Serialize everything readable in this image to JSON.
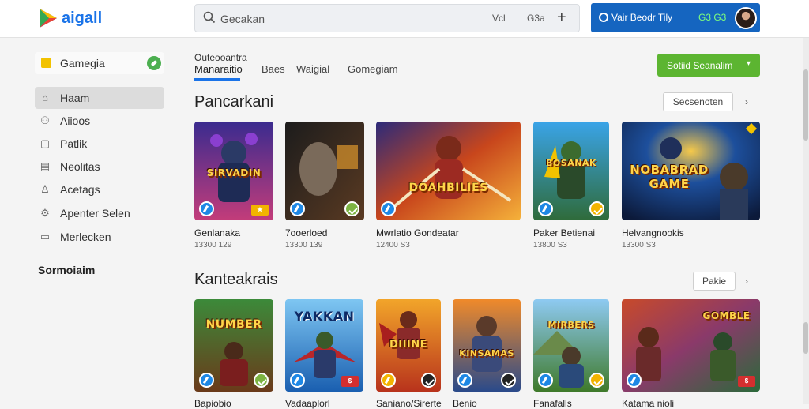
{
  "brand": {
    "name": "aigall"
  },
  "search": {
    "placeholder": "Gecakan",
    "filter_label": "Vcl",
    "count_label": "G3a"
  },
  "account": {
    "label": "Vair Beodr Tily",
    "balance": "G3 G3"
  },
  "sidebar": {
    "header_label": "Gamegia",
    "items": [
      {
        "label": "Haam",
        "icon": "home-icon"
      },
      {
        "label": "Aiioos",
        "icon": "gamepad-icon"
      },
      {
        "label": "Patlik",
        "icon": "list-icon"
      },
      {
        "label": "Neolitas",
        "icon": "news-icon"
      },
      {
        "label": "Acetags",
        "icon": "user-icon"
      },
      {
        "label": "Apenter Selen",
        "icon": "settings-icon"
      },
      {
        "label": "Merlecken",
        "icon": "folder-icon"
      }
    ],
    "section_label": "Sormoiaim"
  },
  "tabs": {
    "kicker": "Outeooantra",
    "items": [
      "Manaraitio",
      "Baes",
      "Waigial",
      "Gomegiam"
    ],
    "cta_label": "Sotiid Seanalim"
  },
  "sections": [
    {
      "title": "Pancarkani",
      "button_label": "Secsenoten",
      "cards": [
        {
          "title": "Genlanaka",
          "meta": "13300  129",
          "art_text": "SIRVADIN"
        },
        {
          "title": "7ooerloed",
          "meta": "13300  139",
          "art_text": ""
        },
        {
          "title": "Mwrlatio Gondeatar",
          "meta": "12400  S3",
          "art_text": "DOAHBILIES"
        },
        {
          "title": "Paker Betienai",
          "meta": "13800  S3",
          "art_text": "BOSANAK"
        },
        {
          "title": "Helvangnookis",
          "meta": "13300  S3",
          "art_text": "NOBABRAD GAME"
        }
      ]
    },
    {
      "title": "Kanteakrais",
      "button_label": "Pakie",
      "cards": [
        {
          "title": "Bapiobio",
          "art_text": "NUMBER"
        },
        {
          "title": "Vadaaplorl",
          "art_text": "YAKKAN"
        },
        {
          "title": "Saniano/Sirerte",
          "art_text": "DIIINE"
        },
        {
          "title": "Benio",
          "art_text": "KINSAMAS"
        },
        {
          "title": "Fanafalls",
          "art_text": "MIRBERS"
        },
        {
          "title": "Katama nioli",
          "art_text": "GOMBLE"
        }
      ]
    }
  ],
  "colors": {
    "accent": "#1a73e8",
    "cta": "#5cb531",
    "account": "#1565c0"
  }
}
